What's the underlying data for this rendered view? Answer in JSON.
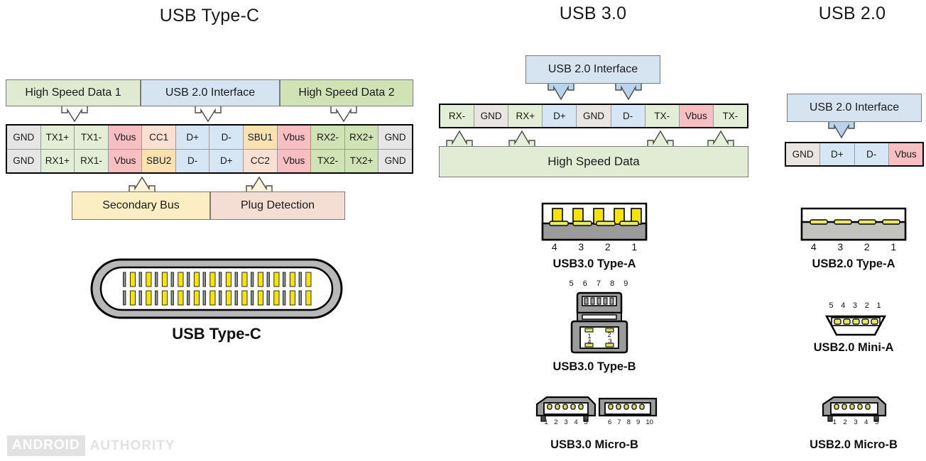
{
  "titles": {
    "typec": "USB Type-C",
    "usb30": "USB 3.0",
    "usb20": "USB 2.0"
  },
  "typec": {
    "groups": [
      {
        "label": "High Speed Data 1",
        "color": "#dfead0"
      },
      {
        "label": "USB 2.0 Interface",
        "color": "#d6e4f2"
      },
      {
        "label": "High Speed Data 2",
        "color": "#cfe3b4"
      }
    ],
    "row_top": [
      {
        "label": "GND",
        "color": "#e6e6e6"
      },
      {
        "label": "TX1+",
        "color": "#e2eed6"
      },
      {
        "label": "TX1-",
        "color": "#e2eed6"
      },
      {
        "label": "Vbus",
        "color": "#f8bfc2"
      },
      {
        "label": "CC1",
        "color": "#fae0d2"
      },
      {
        "label": "D+",
        "color": "#d7e6f4"
      },
      {
        "label": "D-",
        "color": "#d7e6f4"
      },
      {
        "label": "SBU1",
        "color": "#fae2b0"
      },
      {
        "label": "Vbus",
        "color": "#f8bfc2"
      },
      {
        "label": "RX2-",
        "color": "#cfe3b4"
      },
      {
        "label": "RX2+",
        "color": "#cfe3b4"
      },
      {
        "label": "GND",
        "color": "#e6e6e6"
      }
    ],
    "row_bottom": [
      {
        "label": "GND",
        "color": "#e6e6e6"
      },
      {
        "label": "RX1+",
        "color": "#e2eed6"
      },
      {
        "label": "RX1-",
        "color": "#e2eed6"
      },
      {
        "label": "Vbus",
        "color": "#f8bfc2"
      },
      {
        "label": "SBU2",
        "color": "#fae2b0"
      },
      {
        "label": "D-",
        "color": "#d7e6f4"
      },
      {
        "label": "D+",
        "color": "#d7e6f4"
      },
      {
        "label": "CC2",
        "color": "#fae0d2"
      },
      {
        "label": "Vbus",
        "color": "#f8bfc2"
      },
      {
        "label": "TX2-",
        "color": "#cfe3b4"
      },
      {
        "label": "TX2+",
        "color": "#cfe3b4"
      },
      {
        "label": "GND",
        "color": "#e6e6e6"
      }
    ],
    "lower_groups": [
      {
        "label": "Secondary Bus",
        "color": "#fbeec2"
      },
      {
        "label": "Plug Detection",
        "color": "#f4ddd2"
      }
    ],
    "plug_label": "USB Type-C"
  },
  "usb30": {
    "interface_label": "USB 2.0 Interface",
    "interface_color": "#d6e4f2",
    "row": [
      {
        "label": "RX-",
        "color": "#e2eed6"
      },
      {
        "label": "GND",
        "color": "#e8e5e3"
      },
      {
        "label": "RX+",
        "color": "#e2eed6"
      },
      {
        "label": "D+",
        "color": "#d7e6f4"
      },
      {
        "label": "GND",
        "color": "#e8e5e3"
      },
      {
        "label": "D-",
        "color": "#d7e6f4"
      },
      {
        "label": "TX-",
        "color": "#e2eed6"
      },
      {
        "label": "Vbus",
        "color": "#f8bfc2"
      },
      {
        "label": "TX-",
        "color": "#e2eed6"
      }
    ],
    "hsd_label": "High Speed Data",
    "hsd_color": "#e2ecd5",
    "connectors": [
      {
        "name": "USB3.0 Type-A",
        "numbers": [
          "4",
          "3",
          "2",
          "1"
        ]
      },
      {
        "name": "USB3.0 Type-B",
        "numbers_top": [
          "5",
          "6",
          "7",
          "8",
          "9"
        ],
        "numbers_inner": [
          "1",
          "2",
          "3",
          "4"
        ]
      },
      {
        "name": "USB3.0 Micro-B",
        "numbers_left": [
          "1",
          "2",
          "3",
          "4",
          "5"
        ],
        "numbers_right": [
          "6",
          "7",
          "8",
          "9",
          "10"
        ]
      }
    ]
  },
  "usb20": {
    "interface_label": "USB 2.0 Interface",
    "interface_color": "#d6e4f2",
    "row": [
      {
        "label": "GND",
        "color": "#e8e5e3"
      },
      {
        "label": "D+",
        "color": "#d7e6f4"
      },
      {
        "label": "D-",
        "color": "#d7e6f4"
      },
      {
        "label": "Vbus",
        "color": "#f8bfc2"
      }
    ],
    "connectors": [
      {
        "name": "USB2.0 Type-A",
        "numbers": [
          "4",
          "3",
          "2",
          "1"
        ]
      },
      {
        "name": "USB2.0 Mini-A",
        "numbers": [
          "5",
          "4",
          "3",
          "2",
          "1"
        ]
      },
      {
        "name": "USB2.0 Micro-B",
        "numbers": [
          "1",
          "2",
          "3",
          "4",
          "5"
        ]
      }
    ]
  },
  "watermark": {
    "boxed": "ANDROID",
    "plain": "AUTHORITY"
  },
  "colors": {
    "pin_yellow": "#f5e400",
    "connector_gray": "#9b9b9b",
    "outline": "#000000"
  }
}
